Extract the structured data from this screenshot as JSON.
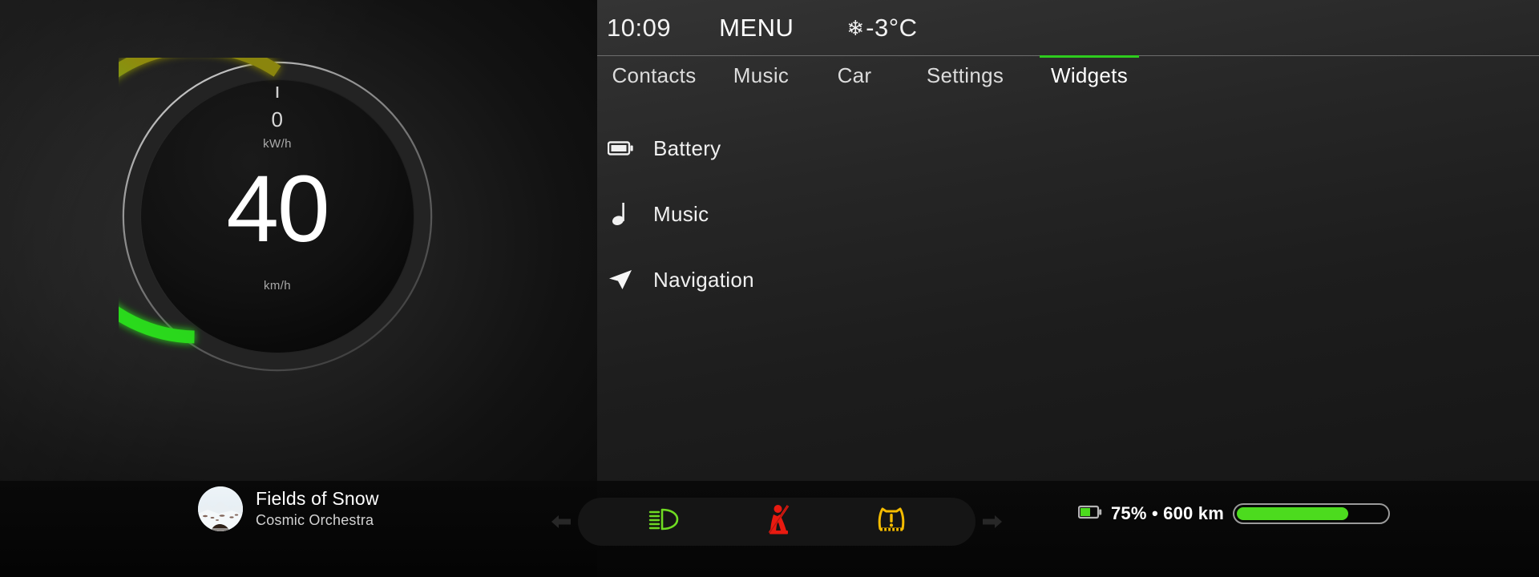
{
  "theme": {
    "accent_green": "#2ecc1e",
    "bright_green": "#4cdb1e",
    "warn_red": "#e81a10",
    "warn_yellow": "#f5bc00",
    "headlight_green": "#6fdb22",
    "arc_start_olive": "#8f8a11",
    "background": "#0c0c0c"
  },
  "cluster": {
    "gauge": {
      "power_value": "0",
      "power_unit": "kW/h",
      "speed_value": "40",
      "speed_unit": "km/h",
      "tick_label": "|"
    },
    "now_playing": {
      "title": "Fields of Snow",
      "artist": "Cosmic Orchestra",
      "album_art_name": "snowy-landscape-album-art"
    },
    "telltales": {
      "prev_arrow": "◀",
      "next_arrow": "▶",
      "items": [
        {
          "name": "low-beam-headlight",
          "color": "#6fdb22",
          "label": "Low beam headlights"
        },
        {
          "name": "seatbelt-warning",
          "color": "#e81a10",
          "label": "Seatbelt unfastened"
        },
        {
          "name": "tire-pressure-warning",
          "color": "#f5bc00",
          "label": "Tire pressure low"
        }
      ]
    },
    "battery": {
      "icon": "battery-icon",
      "text": "75% • 600 km",
      "percent": 75
    }
  },
  "infotainment": {
    "header": {
      "clock": "10:09",
      "menu_label": "MENU",
      "weather_icon": "snowflake-icon",
      "temperature": "-3°C"
    },
    "tabs": [
      {
        "label": "Contacts",
        "active": false
      },
      {
        "label": "Music",
        "active": false
      },
      {
        "label": "Car",
        "active": false
      },
      {
        "label": "Settings",
        "active": false
      },
      {
        "label": "Widgets",
        "active": true
      }
    ],
    "widgets": [
      {
        "label": "Battery",
        "icon": "battery-icon"
      },
      {
        "label": "Music",
        "icon": "music-note-icon"
      },
      {
        "label": "Navigation",
        "icon": "navigation-arrow-icon"
      }
    ]
  }
}
